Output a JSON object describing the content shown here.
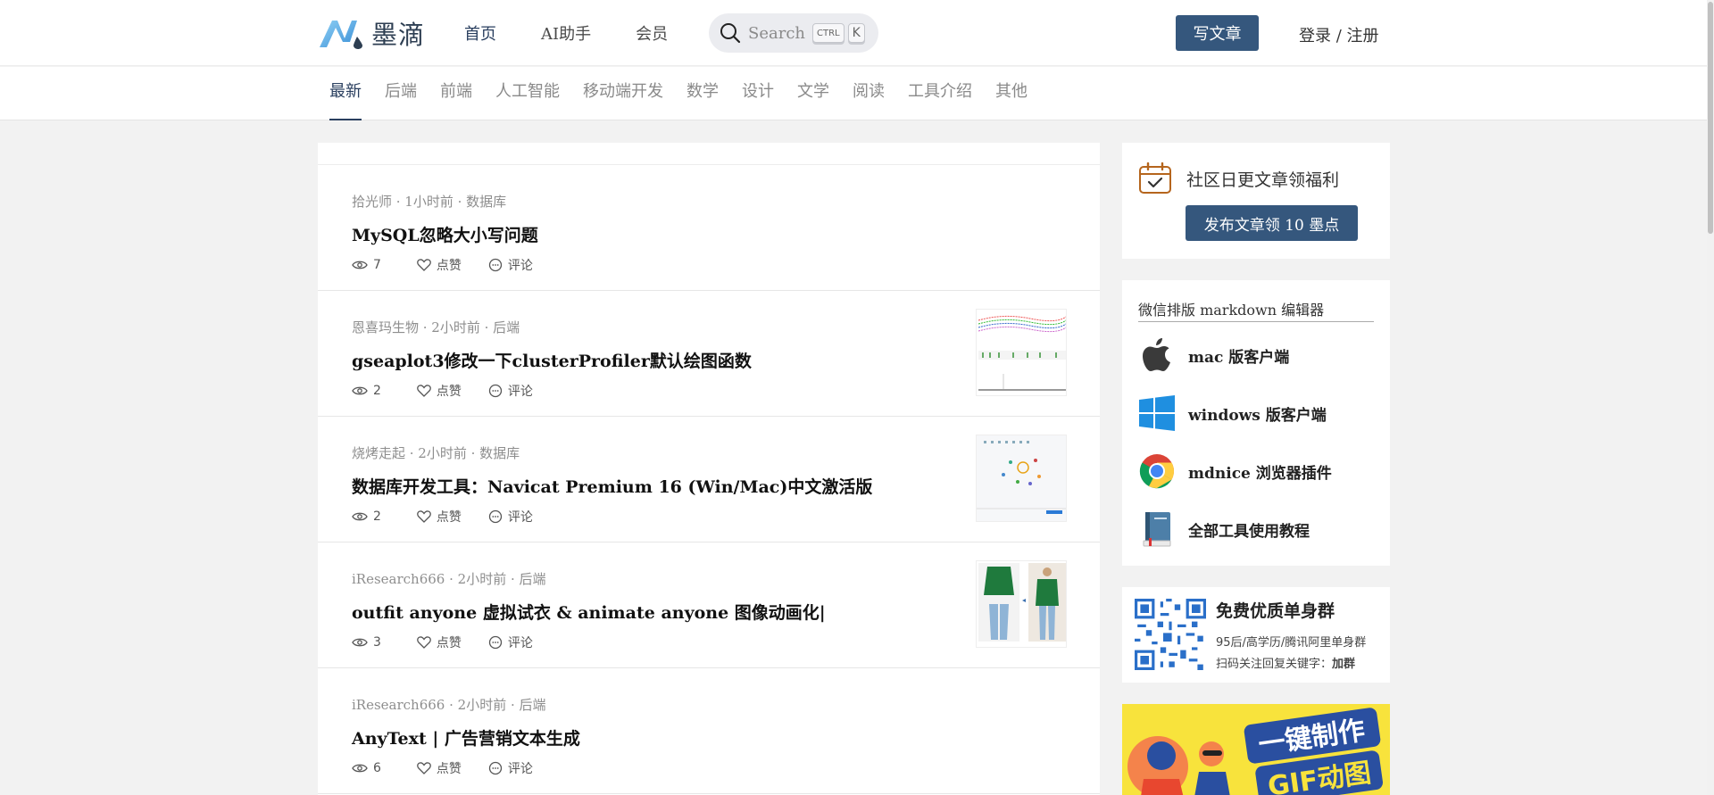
{
  "header": {
    "logo_text": "墨滴",
    "nav": [
      {
        "label": "首页"
      },
      {
        "label": "AI助手"
      },
      {
        "label": "会员"
      }
    ],
    "search": {
      "placeholder": "Search",
      "shortcut_key1": "CTRL",
      "shortcut_key2": "K"
    },
    "write_button": "写文章",
    "login": "登录 / 注册"
  },
  "categories": [
    "最新",
    "后端",
    "前端",
    "人工智能",
    "移动端开发",
    "数学",
    "设计",
    "文学",
    "阅读",
    "工具介绍",
    "其他"
  ],
  "articles": [
    {
      "meta": "拾光师 · 1小时前 · 数据库",
      "title": "MySQL忽略大小写问题",
      "views": "7",
      "like": "点赞",
      "comment": "评论"
    },
    {
      "meta": "恩喜玛生物 · 2小时前 · 后端",
      "title": "gseaplot3修改一下clusterProfiler默认绘图函数",
      "views": "2",
      "like": "点赞",
      "comment": "评论"
    },
    {
      "meta": "烧烤走起 · 2小时前 · 数据库",
      "title": "数据库开发工具：Navicat Premium 16 (Win/Mac)中文激活版",
      "views": "2",
      "like": "点赞",
      "comment": "评论"
    },
    {
      "meta": "iResearch666 · 2小时前 · 后端",
      "title": "outfit anyone 虚拟试衣 & animate anyone 图像动画化|",
      "views": "3",
      "like": "点赞",
      "comment": "评论"
    },
    {
      "meta": "iResearch666 · 2小时前 · 后端",
      "title": "AnyText | 广告营销文本生成",
      "views": "6",
      "like": "点赞",
      "comment": "评论"
    }
  ],
  "sidebar": {
    "promo": {
      "title": "社区日更文章领福利",
      "button": "发布文章领 10 墨点"
    },
    "tools": {
      "heading": "微信排版 markdown 编辑器",
      "items": [
        {
          "label": "mac 版客户端",
          "icon": "apple-icon"
        },
        {
          "label": "windows 版客户端",
          "icon": "windows-icon"
        },
        {
          "label": "mdnice 浏览器插件",
          "icon": "chrome-icon"
        },
        {
          "label": "全部工具使用教程",
          "icon": "book-icon"
        }
      ]
    },
    "group": {
      "title": "免费优质单身群",
      "line1": "95后/高学历/腾讯阿里单身群",
      "line2_prefix": "扫码关注回复关键字：",
      "line2_keyword": "加群"
    },
    "gif_banner": {
      "line1": "一键制作",
      "line2": "GIF动图"
    }
  },
  "colors": {
    "accent": "#35577d",
    "active_text": "#2a3f5f",
    "banner_yellow": "#f8e33c"
  }
}
